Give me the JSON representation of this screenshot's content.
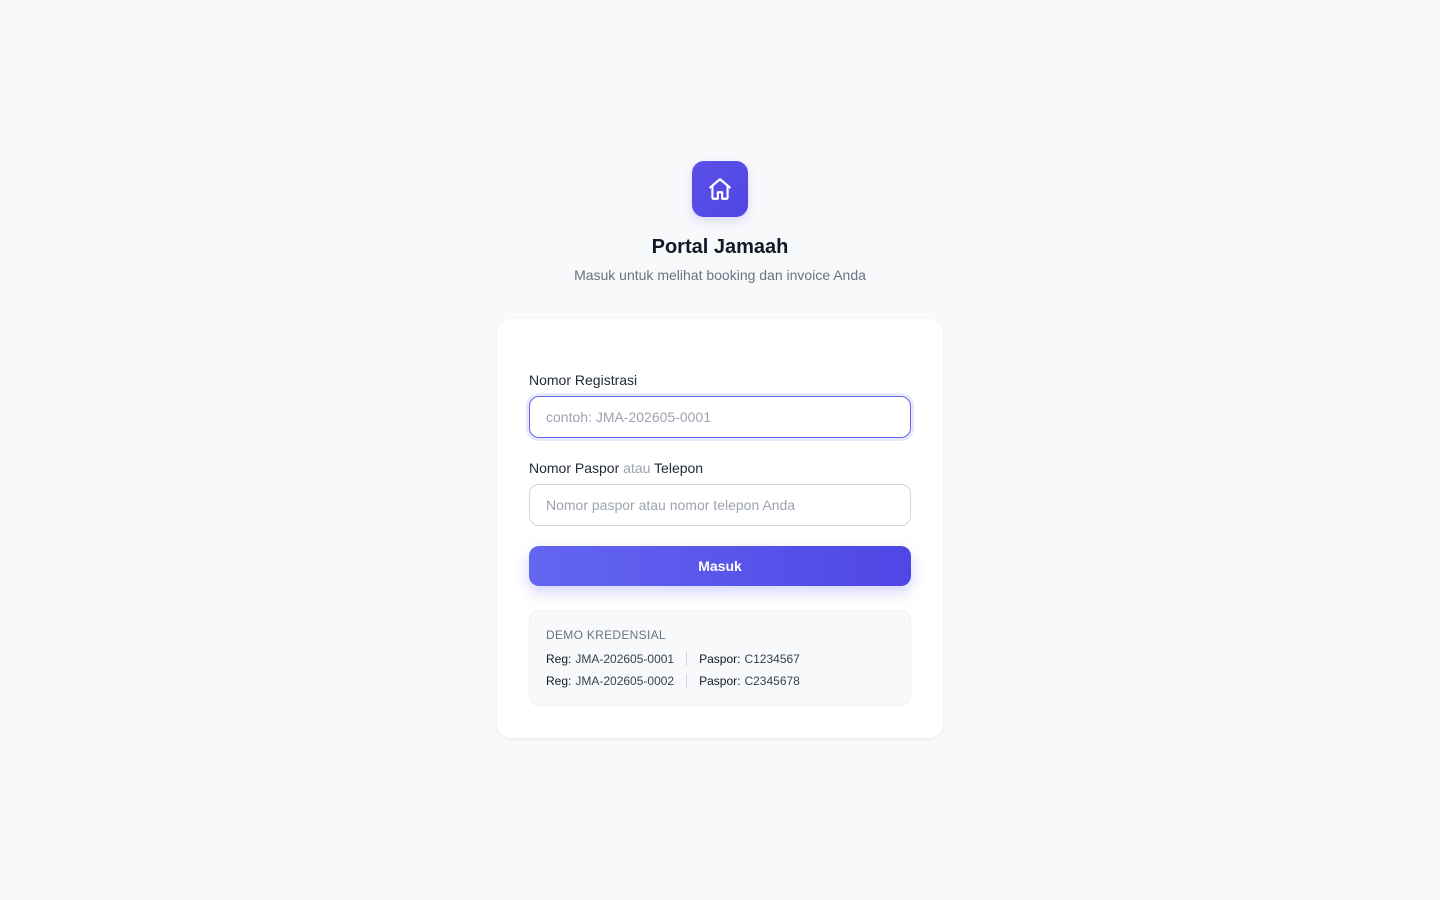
{
  "brand": {
    "icon": "home-icon",
    "accent": "#4f46e5",
    "title": "Portal Jamaah",
    "subtitle": "Masuk untuk melihat booking dan invoice Anda"
  },
  "form": {
    "registration": {
      "label": "Nomor Registrasi",
      "placeholder": "contoh: JMA-202605-0001",
      "value": ""
    },
    "credential": {
      "label_main": "Nomor Paspor",
      "label_or": "atau",
      "label_alt": "Telepon",
      "placeholder": "Nomor paspor atau nomor telepon Anda",
      "value": ""
    },
    "submit_label": "Masuk"
  },
  "demo": {
    "title": "DEMO KREDENSIAL",
    "reg_key": "Reg:",
    "passport_key": "Paspor:",
    "accounts": [
      {
        "reg": "JMA-202605-0001",
        "passport": "C1234567"
      },
      {
        "reg": "JMA-202605-0002",
        "passport": "C2345678"
      }
    ]
  }
}
